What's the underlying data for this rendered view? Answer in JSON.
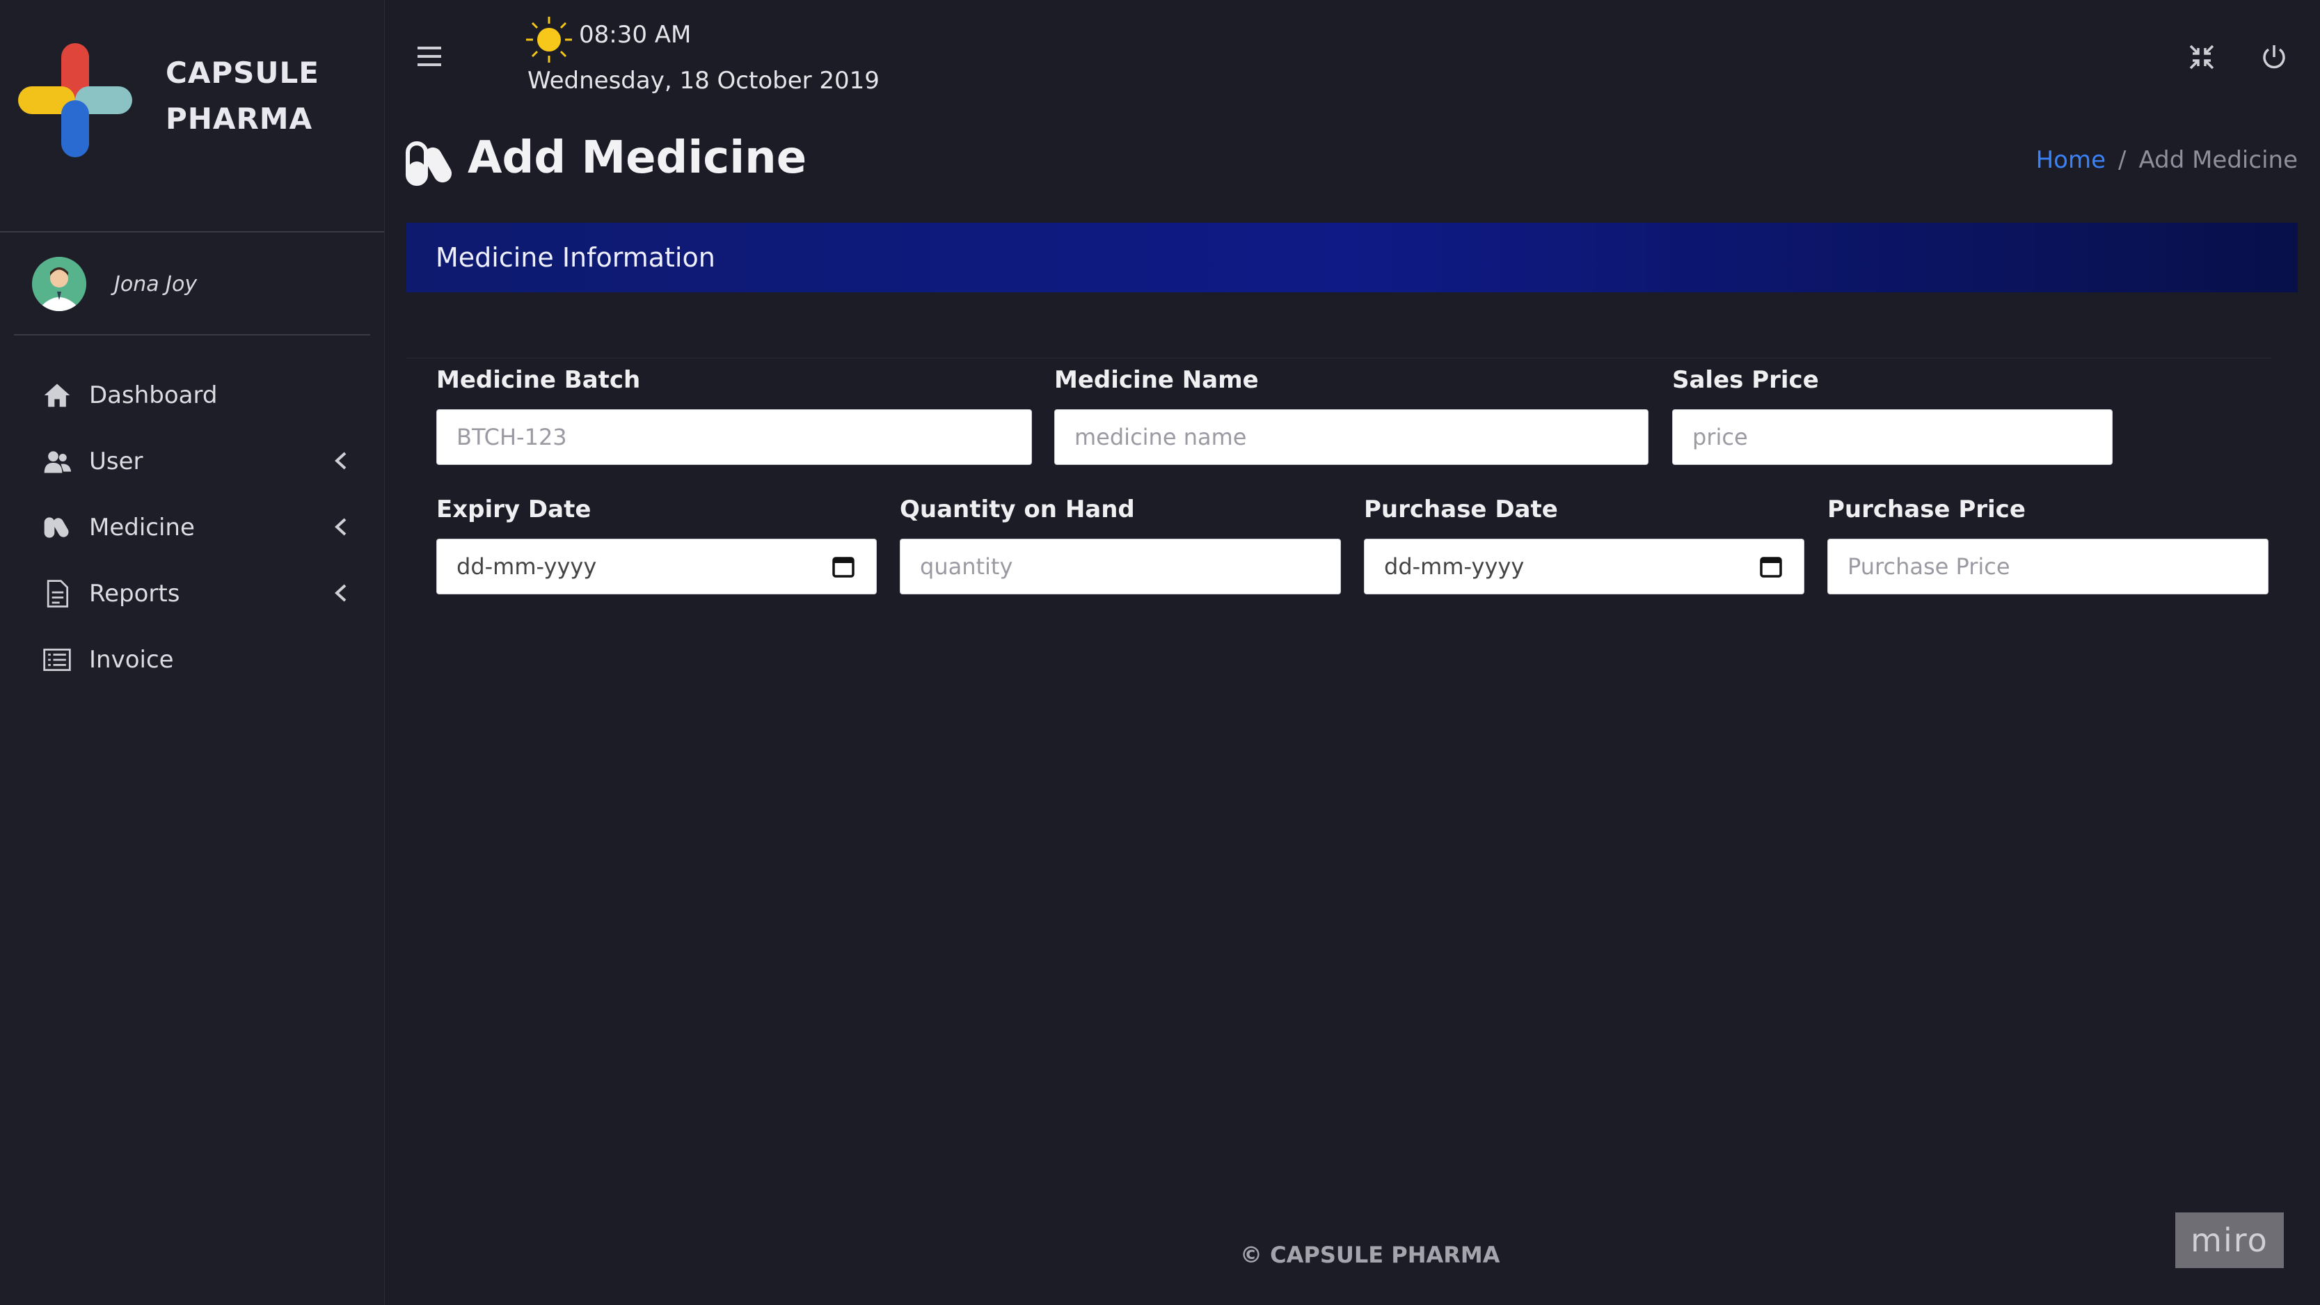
{
  "brand": {
    "line1": "CAPSULE",
    "line2": "PHARMA"
  },
  "user": {
    "name": "Jona Joy"
  },
  "sidebar": {
    "items": [
      {
        "label": "Dashboard",
        "icon": "home-icon",
        "has_submenu": false
      },
      {
        "label": "User",
        "icon": "users-icon",
        "has_submenu": true
      },
      {
        "label": "Medicine",
        "icon": "capsules-icon",
        "has_submenu": true
      },
      {
        "label": "Reports",
        "icon": "report-icon",
        "has_submenu": true
      },
      {
        "label": "Invoice",
        "icon": "invoice-icon",
        "has_submenu": false
      }
    ]
  },
  "topbar": {
    "time": "08:30 AM",
    "date": "Wednesday, 18 October 2019"
  },
  "page": {
    "title": "Add Medicine"
  },
  "breadcrumb": {
    "home": "Home",
    "separator": "/",
    "current": "Add Medicine"
  },
  "card": {
    "title": "Medicine Information"
  },
  "form": {
    "medicine_batch": {
      "label": "Medicine Batch",
      "placeholder": "BTCH-123"
    },
    "medicine_name": {
      "label": "Medicine Name",
      "placeholder": "medicine name"
    },
    "sales_price": {
      "label": "Sales Price",
      "placeholder": "price"
    },
    "expiry_date": {
      "label": "Expiry Date",
      "placeholder": "dd-mm-yyyy"
    },
    "quantity": {
      "label": "Quantity on Hand",
      "placeholder": "quantity"
    },
    "purchase_date": {
      "label": "Purchase Date",
      "placeholder": "dd-mm-yyyy"
    },
    "purchase_price": {
      "label": "Purchase Price",
      "placeholder": "Purchase Price"
    }
  },
  "footer": {
    "text": "© CAPSULE PHARMA"
  },
  "watermark": {
    "text": "miro"
  },
  "colors": {
    "background": "#1b1c26",
    "header_gradient": "#0f1a86",
    "link": "#3b82f6"
  }
}
